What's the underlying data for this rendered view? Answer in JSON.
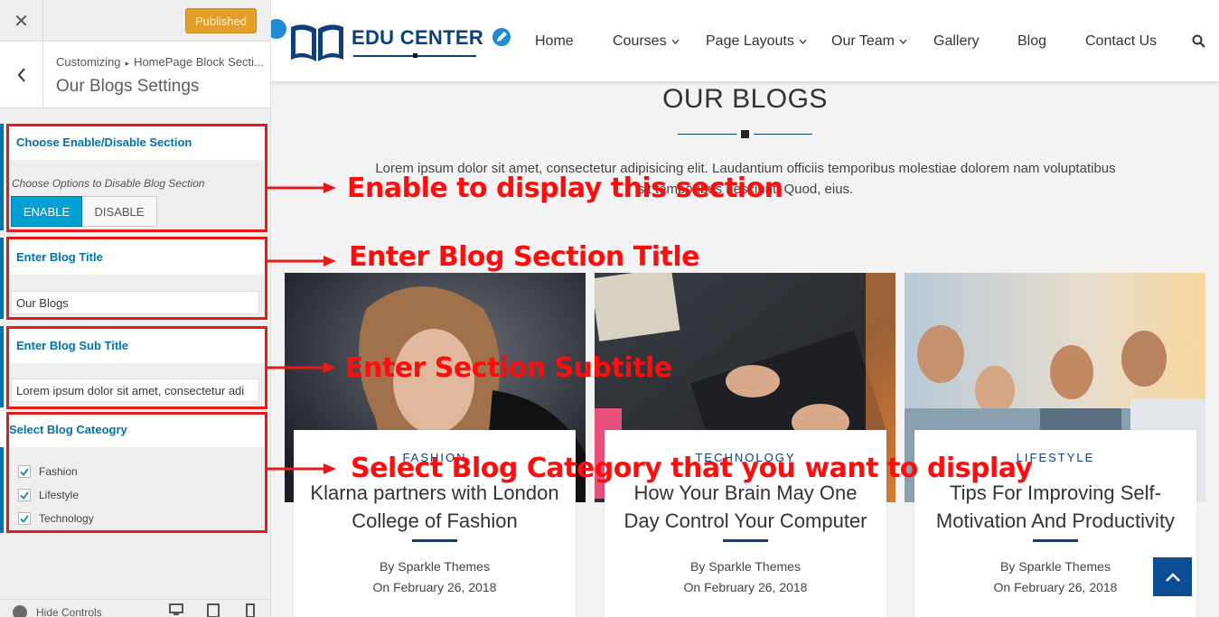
{
  "sidebar": {
    "published_label": "Published",
    "breadcrumb": [
      "Customizing",
      "HomePage Block Secti..."
    ],
    "title": "Our Blogs Settings",
    "enable_section": {
      "heading": "Choose Enable/Disable Section",
      "description": "Choose Options to Disable Blog Section",
      "enable_label": "ENABLE",
      "disable_label": "DISABLE",
      "selected": "ENABLE"
    },
    "blog_title": {
      "heading": "Enter Blog Title",
      "value": "Our Blogs"
    },
    "blog_subtitle": {
      "heading": "Enter Blog Sub Title",
      "value": "Lorem ipsum dolor sit amet, consectetur adi"
    },
    "blog_category": {
      "heading": "Select Blog Cateogry",
      "options": [
        {
          "label": "Fashion",
          "checked": true
        },
        {
          "label": "Lifestyle",
          "checked": true
        },
        {
          "label": "Technology",
          "checked": true
        }
      ]
    },
    "footer": {
      "hide_controls_label": "Hide Controls"
    }
  },
  "site": {
    "logo_text": "EDU CENTER",
    "nav": [
      {
        "label": "Home",
        "has_dropdown": false
      },
      {
        "label": "Courses",
        "has_dropdown": true
      },
      {
        "label": "Page Layouts",
        "has_dropdown": true
      },
      {
        "label": "Our Team",
        "has_dropdown": true
      },
      {
        "label": "Gallery",
        "has_dropdown": false
      },
      {
        "label": "Blog",
        "has_dropdown": false
      },
      {
        "label": "Contact Us",
        "has_dropdown": false
      }
    ],
    "section_title": "OUR BLOGS",
    "section_subtitle": "Lorem ipsum dolor sit amet, consectetur adipisicing elit. Laudantium officiis temporibus molestiae dolorem nam voluptatibus sit temporibus nesciunt. Quod, eius.",
    "posts": [
      {
        "category": "FASHION",
        "title": "Klarna partners with London College of Fashion",
        "author": "By Sparkle Themes",
        "date": "On February 26, 2018"
      },
      {
        "category": "TECHNOLOGY",
        "title": "How Your Brain May One Day Control Your Computer",
        "author": "By Sparkle Themes",
        "date": "On February 26, 2018"
      },
      {
        "category": "LIFESTYLE",
        "title": "Tips For Improving Self-Motivation And Productivity",
        "author": "By Sparkle Themes",
        "date": "On February 26, 2018"
      }
    ]
  },
  "annotations": [
    "Enable to display this section",
    "Enter Blog Section Title",
    "Enter Section Subtitle",
    "Select Blog Category that you want to display"
  ],
  "colors": {
    "brand": "#0d3f7a",
    "accent": "#0073aa",
    "annotation": "#ff0d0d",
    "published": "#e2a02a"
  }
}
